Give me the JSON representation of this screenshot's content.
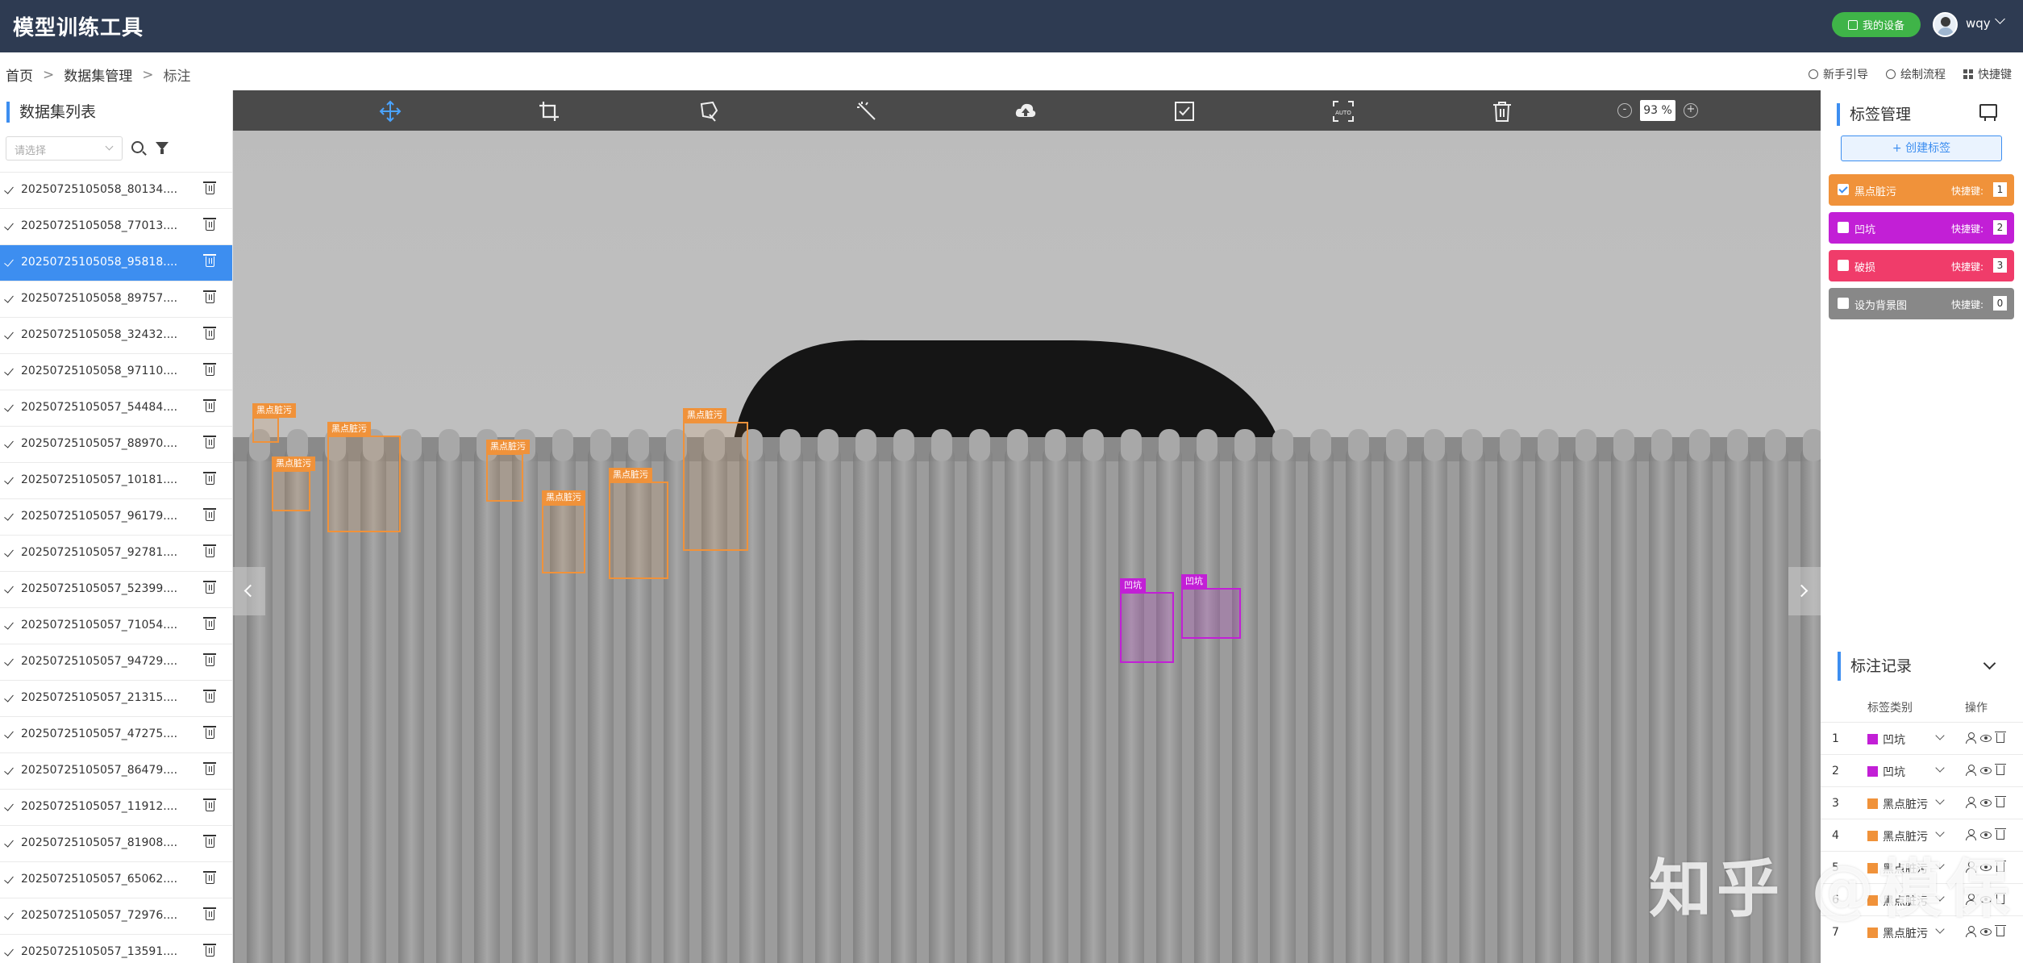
{
  "app": {
    "title": "模型训练工具"
  },
  "header": {
    "device_button": "我的设备",
    "username": "wqy"
  },
  "breadcrumb": {
    "home": "首页",
    "data_mgmt": "数据集管理",
    "current": "标注",
    "sep": ">"
  },
  "top_links": {
    "guide": "新手引导",
    "flow": "绘制流程",
    "hotkeys": "快捷键"
  },
  "dataset_panel": {
    "title": "数据集列表",
    "select_placeholder": "请选择",
    "files": [
      {
        "name": "20250725105058_80134...."
      },
      {
        "name": "20250725105058_77013...."
      },
      {
        "name": "20250725105058_95818...."
      },
      {
        "name": "20250725105058_89757...."
      },
      {
        "name": "20250725105058_32432...."
      },
      {
        "name": "20250725105058_97110...."
      },
      {
        "name": "20250725105057_54484...."
      },
      {
        "name": "20250725105057_88970...."
      },
      {
        "name": "20250725105057_10181...."
      },
      {
        "name": "20250725105057_96179...."
      },
      {
        "name": "20250725105057_92781...."
      },
      {
        "name": "20250725105057_52399...."
      },
      {
        "name": "20250725105057_71054...."
      },
      {
        "name": "20250725105057_94729...."
      },
      {
        "name": "20250725105057_21315...."
      },
      {
        "name": "20250725105057_47275...."
      },
      {
        "name": "20250725105057_86479...."
      },
      {
        "name": "20250725105057_11912...."
      },
      {
        "name": "20250725105057_81908...."
      },
      {
        "name": "20250725105057_65062...."
      },
      {
        "name": "20250725105057_72976...."
      },
      {
        "name": "20250725105057_13591...."
      }
    ],
    "active_index": 2
  },
  "canvas": {
    "zoom": "93 %",
    "zoom_minus": "-",
    "zoom_plus": "+",
    "annotations": [
      {
        "label": "黑点脏污"
      },
      {
        "label": "黑点脏污"
      },
      {
        "label": "黑点脏污"
      },
      {
        "label": "黑点脏污"
      },
      {
        "label": "黑点脏污"
      },
      {
        "label": "黑点脏污"
      },
      {
        "label": "黑点脏污"
      },
      {
        "label": "凹坑"
      },
      {
        "label": "凹坑"
      }
    ],
    "watermark": "知乎 @模保"
  },
  "tag_panel": {
    "title": "标签管理",
    "create_button": "+ 创建标签",
    "hotkey_label": "快捷键:",
    "tags": [
      {
        "name": "黑点脏污",
        "hotkey": "1",
        "color": "#f0923a",
        "checked": true
      },
      {
        "name": "凹坑",
        "hotkey": "2",
        "color": "#c21fd6",
        "checked": false
      },
      {
        "name": "破损",
        "hotkey": "3",
        "color": "#f03c6a",
        "checked": false
      },
      {
        "name": "设为背景图",
        "hotkey": "0",
        "color": "#888888",
        "checked": false
      }
    ]
  },
  "records": {
    "title": "标注记录",
    "col_category": "标签类别",
    "col_ops": "操作",
    "rows": [
      {
        "num": "1",
        "label": "凹坑",
        "color": "#c21fd6"
      },
      {
        "num": "2",
        "label": "凹坑",
        "color": "#c21fd6"
      },
      {
        "num": "3",
        "label": "黑点脏污",
        "color": "#f0923a"
      },
      {
        "num": "4",
        "label": "黑点脏污",
        "color": "#f0923a"
      },
      {
        "num": "5",
        "label": "黑点脏污",
        "color": "#f0923a"
      },
      {
        "num": "6",
        "label": "黑点脏污",
        "color": "#f0923a"
      },
      {
        "num": "7",
        "label": "黑点脏污",
        "color": "#f0923a"
      }
    ]
  }
}
